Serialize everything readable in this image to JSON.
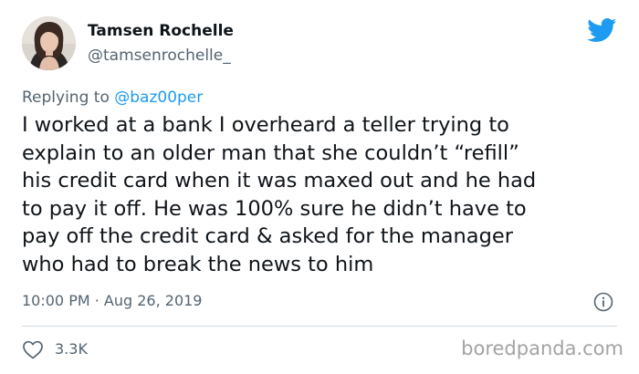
{
  "author": {
    "name": "Tamsen Rochelle",
    "handle": "@tamsenrochelle_"
  },
  "reply": {
    "prefix": "Replying to ",
    "mention": "@baz00per"
  },
  "tweet": {
    "lines": [
      "I worked at a bank I overheard a teller trying to",
      "explain to an older man that she couldn’t “refill”",
      "his credit card when it was maxed out and he had",
      "to pay it off. He was 100% sure he didn’t have to",
      "pay off the credit card & asked for the manager",
      "who had to break the news to him"
    ]
  },
  "meta": {
    "timestamp": "10:00 PM · Aug 26, 2019"
  },
  "stats": {
    "likes": "3.3K"
  },
  "watermark": "boredpanda.com",
  "colors": {
    "twitter_blue": "#1d9bf0",
    "secondary_text": "#536471",
    "divider": "#cfd9de",
    "watermark": "#a3a3a3"
  },
  "icons": {
    "brand": "twitter-bird-icon",
    "info": "info-icon",
    "like": "heart-icon"
  }
}
